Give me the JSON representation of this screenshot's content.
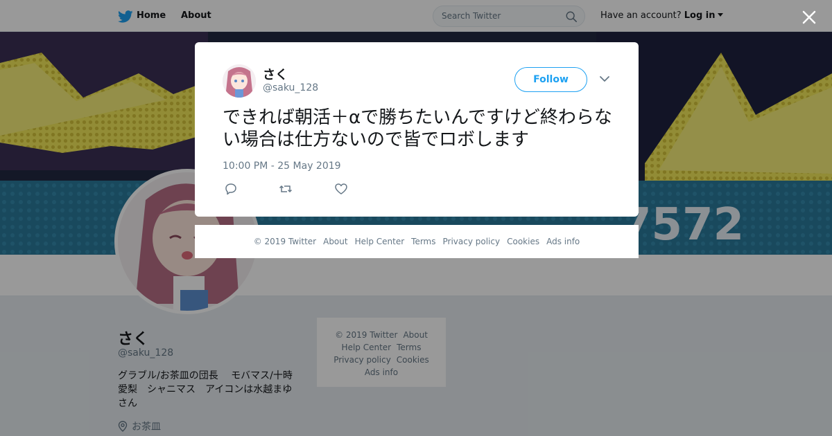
{
  "topbar": {
    "home_label": "Home",
    "about_label": "About",
    "search_placeholder": "Search Twitter",
    "account_prompt": "Have an account?",
    "login_label": "Log in"
  },
  "banner": {
    "number_text": "7572"
  },
  "profile": {
    "name": "さく",
    "handle": "@saku_128",
    "bio": "グラブル/お茶皿の団長　 モバマス/十時愛梨　シャニマス　アイコンは水越まゆさん",
    "location": "お茶皿"
  },
  "side_footer": {
    "links": [
      "© 2019 Twitter",
      "About",
      "Help Center",
      "Terms",
      "Privacy policy",
      "Cookies",
      "Ads info"
    ]
  },
  "tweet": {
    "author_name": "さく",
    "author_handle": "@saku_128",
    "follow_label": "Follow",
    "text": "できれば朝活＋αで勝ちたいんですけど終わらない場合は仕方ないので皆でロボします",
    "timestamp": "10:00 PM - 25 May 2019"
  },
  "modal_footer": {
    "links": [
      "© 2019 Twitter",
      "About",
      "Help Center",
      "Terms",
      "Privacy policy",
      "Cookies",
      "Ads info"
    ]
  },
  "colors": {
    "twitter_blue": "#1da1f2",
    "text_primary": "#14171a",
    "text_secondary": "#657786",
    "banner_yellow": "#f2e64a",
    "banner_blue": "#2d3a66"
  },
  "icons": [
    "twitter-bird-icon",
    "search-icon",
    "close-icon",
    "chevron-down-icon",
    "reply-icon",
    "retweet-icon",
    "like-icon",
    "location-pin-icon"
  ]
}
